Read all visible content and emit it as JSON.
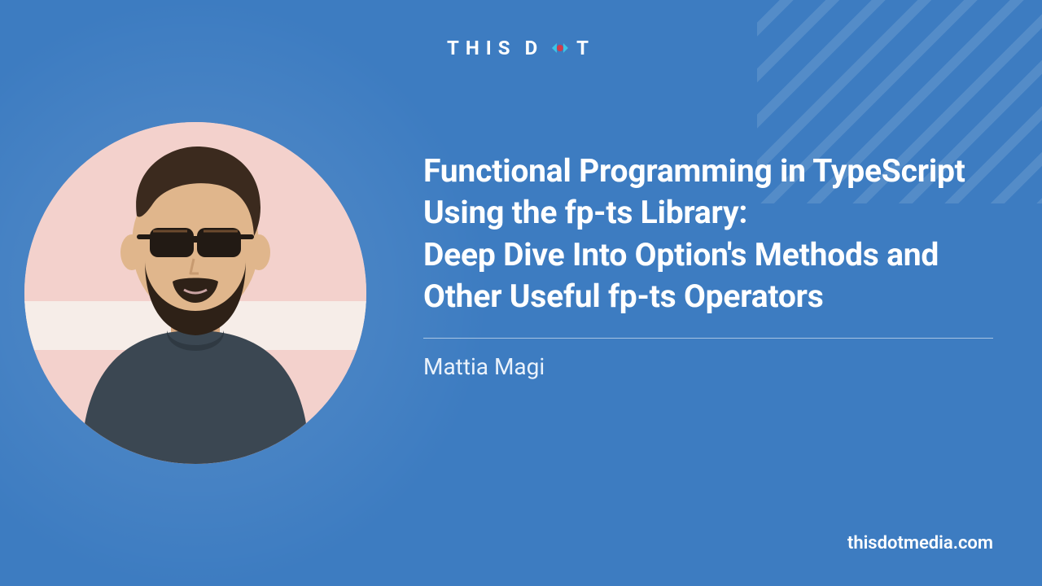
{
  "brand": {
    "part1": "THIS",
    "part2": "D",
    "part3": "T",
    "dot_color_outer": "#3bc3e6",
    "dot_color_inner": "#d03c4a"
  },
  "title": "Functional Programming in TypeScript Using the fp-ts Library:\nDeep Dive Into Option's Methods and Other Useful fp-ts Operators",
  "author": "Mattia Magi",
  "website": "thisdotmedia.com",
  "colors": {
    "background": "#3d7cc1",
    "text": "#ffffff"
  }
}
